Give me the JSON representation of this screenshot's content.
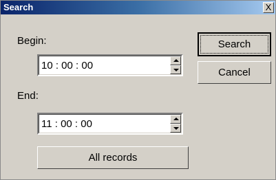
{
  "window": {
    "title": "Search",
    "close_glyph": "X"
  },
  "begin": {
    "label": "Begin:",
    "value": "10 : 00 : 00"
  },
  "end": {
    "label": "End:",
    "value": "11 : 00 : 00"
  },
  "buttons": {
    "search": "Search",
    "cancel": "Cancel",
    "all_records": "All records"
  },
  "icons": {
    "spin_up": "spin-up-arrow-icon",
    "spin_down": "spin-down-arrow-icon",
    "close": "close-icon"
  }
}
